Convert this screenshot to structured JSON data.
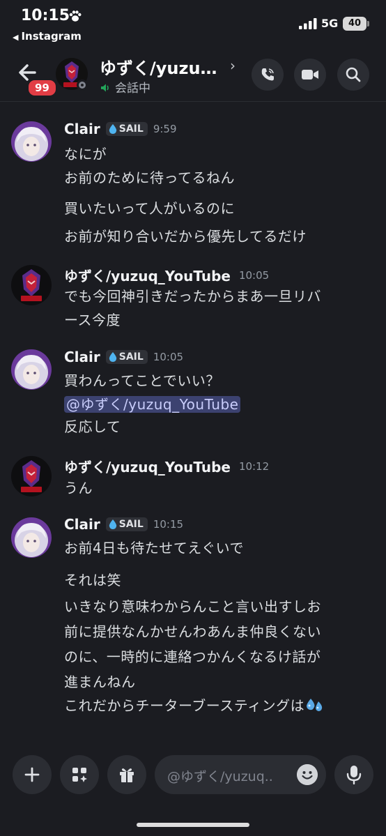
{
  "status_bar": {
    "time": "10:15",
    "back_app": "Instagram",
    "network": "5G",
    "battery": "40"
  },
  "header": {
    "back_badge": "99",
    "title": "ゆずく/yuzu…",
    "subtitle": "会話中"
  },
  "messages": [
    {
      "author": "Clair",
      "tag": "SAIL",
      "time": "9:59",
      "lines": [
        "なにが",
        "お前のために待ってるねん",
        "買いたいって人がいるのに",
        "お前が知り合いだから優先してるだけ"
      ]
    },
    {
      "author": "ゆずく/yuzuq_YouTube",
      "time": "10:05",
      "lines": [
        "でも今回神引きだったからまあ一旦リバ",
        "ース今度"
      ]
    },
    {
      "author": "Clair",
      "tag": "SAIL",
      "time": "10:05",
      "lines": [
        "買わんってことでいい？",
        "@ゆずく/yuzuq_YouTube",
        "反応して"
      ]
    },
    {
      "author": "ゆずく/yuzuq_YouTube",
      "time": "10:12",
      "lines": [
        "うん"
      ]
    },
    {
      "author": "Clair",
      "tag": "SAIL",
      "time": "10:15",
      "lines": [
        "お前4日も待たせてえぐいで",
        "それは笑",
        "いきなり意味わからんこと言い出すしお",
        "前に提供なんかせんわあんま仲良くない",
        "のに、一時的に連絡つかんくなるけ話が",
        "進まんねん",
        "これだからチーターブースティングは"
      ]
    }
  ],
  "composer": {
    "placeholder": "@ゆずく/yuzuq.."
  },
  "colors": {
    "background": "#1b1c21",
    "badge": "#e23d45",
    "mention_bg": "#3c4270",
    "mention_text": "#c9cdfb",
    "online_speaker": "#23a55a"
  }
}
